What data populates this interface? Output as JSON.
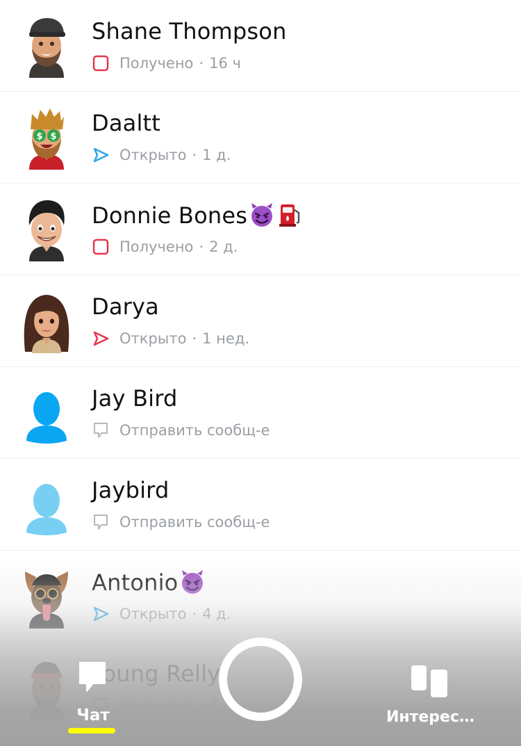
{
  "chats": [
    {
      "name": "Shane Thompson",
      "emoji": [],
      "avatar": "bitmoji-cap-beard-icon",
      "status_icon": "received-snap-icon",
      "status_text": "Получено",
      "time": "16 ч"
    },
    {
      "name": "Daaltt",
      "emoji": [],
      "avatar": "bitmoji-money-eyes-icon",
      "status_icon": "opened-snap-blue-icon",
      "status_text": "Открыто",
      "time": "1 д."
    },
    {
      "name": "Donnie Bones",
      "emoji": [
        "smiling-imp-emoji-icon",
        "fuel-pump-emoji-icon"
      ],
      "avatar": "bitmoji-dark-hair-icon",
      "status_icon": "received-snap-icon",
      "status_text": "Получено",
      "time": "2 д."
    },
    {
      "name": "Darya",
      "emoji": [],
      "avatar": "bitmoji-long-hair-icon",
      "status_icon": "opened-snap-red-icon",
      "status_text": "Открыто",
      "time": "1 нед."
    },
    {
      "name": "Jay Bird",
      "emoji": [],
      "avatar": "default-silhouette-blue-icon",
      "status_icon": "chat-bubble-outline-icon",
      "status_text": "Отправить сообщ-е",
      "time": ""
    },
    {
      "name": "Jaybird",
      "emoji": [],
      "avatar": "default-silhouette-light-blue-icon",
      "status_icon": "chat-bubble-outline-icon",
      "status_text": "Отправить сообщ-е",
      "time": ""
    },
    {
      "name": "Antonio",
      "emoji": [
        "smiling-imp-emoji-icon"
      ],
      "avatar": "bitmoji-dog-filter-icon",
      "status_icon": "opened-snap-blue-icon",
      "status_text": "Открыто",
      "time": "4 д."
    },
    {
      "name": "Young Relly",
      "emoji": [],
      "avatar": "bitmoji-headband-icon",
      "status_icon": "received-chat-blue-icon",
      "status_text": "Получено",
      "time": "4 д."
    }
  ],
  "separator": "·",
  "nav": {
    "chat_label": "Чат",
    "discover_label": "Интерес…"
  },
  "colors": {
    "received_red": "#e8344c",
    "opened_blue": "#2ea6e8",
    "opened_red": "#e8344c",
    "silhouette_blue": "#0aa6f2",
    "silhouette_light_blue": "#79cff3",
    "underline_yellow": "#fffc00",
    "secondary_text": "#9a9ea3"
  }
}
